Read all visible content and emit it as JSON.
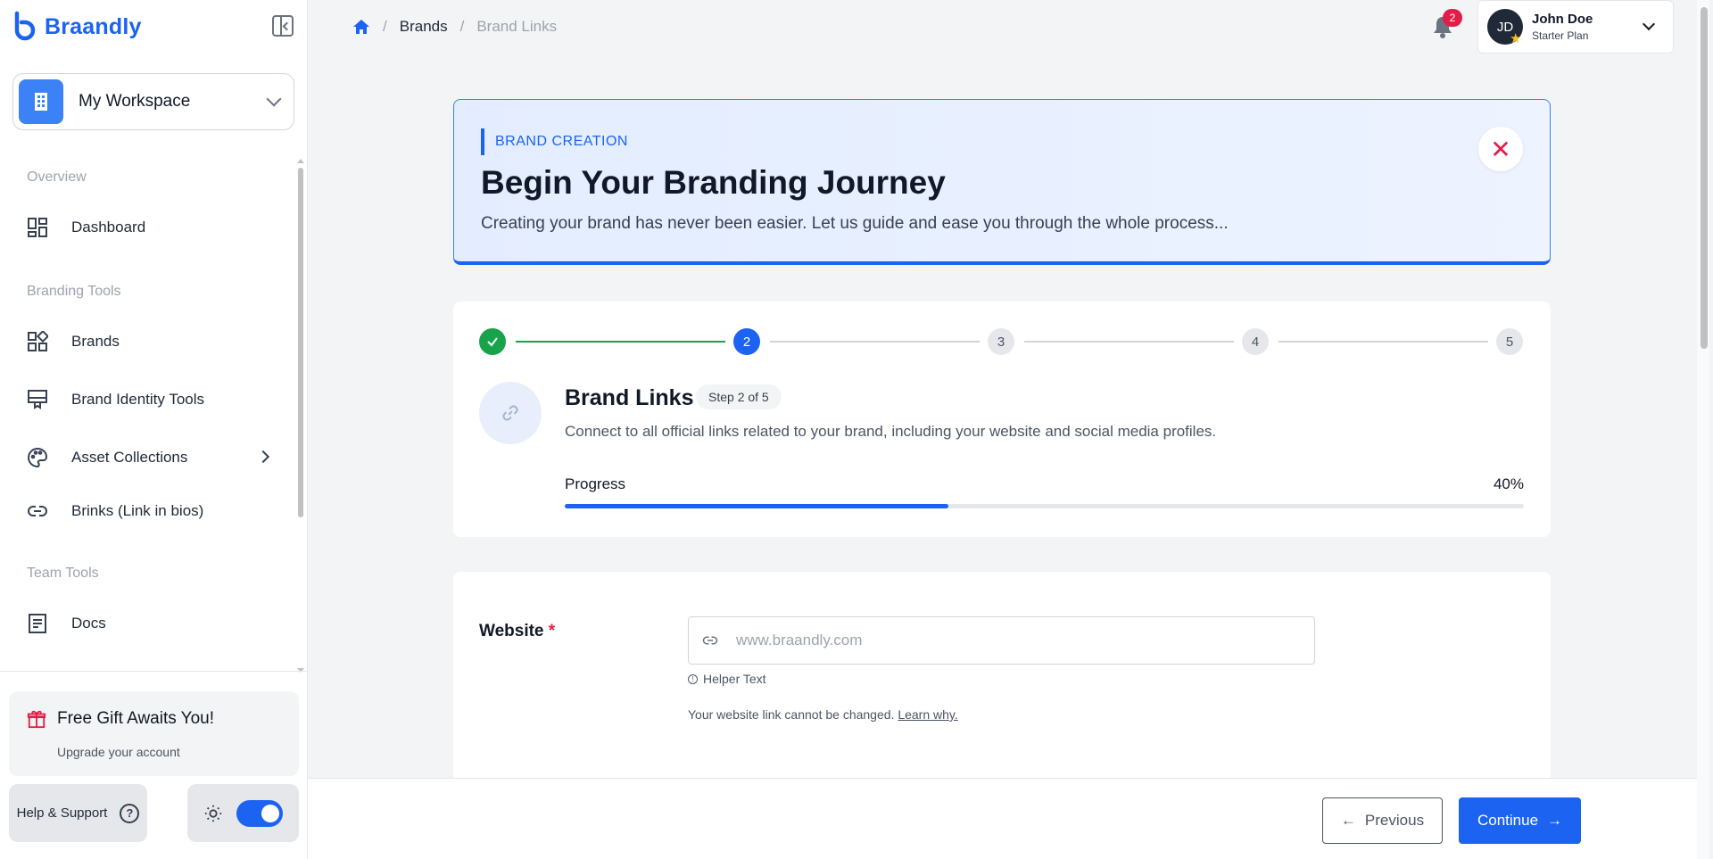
{
  "app": {
    "name": "Braandly",
    "brand_color": "#1b63f0"
  },
  "workspace": {
    "label": "My Workspace"
  },
  "sidebar": {
    "sections": [
      {
        "label": "Overview"
      },
      {
        "label": "Branding Tools"
      },
      {
        "label": "Team Tools"
      }
    ],
    "items": [
      {
        "label": "Dashboard",
        "icon": "dashboard-icon"
      },
      {
        "label": "Brands",
        "icon": "brands-icon"
      },
      {
        "label": "Brand Identity Tools",
        "icon": "monitor-icon"
      },
      {
        "label": "Asset Collections",
        "icon": "palette-icon"
      },
      {
        "label": "Brinks (Link in bios)",
        "icon": "link-icon"
      },
      {
        "label": "Docs",
        "icon": "document-icon"
      }
    ],
    "gift": {
      "title": "Free Gift Awaits You!",
      "subtitle": "Upgrade your account"
    },
    "help_label": "Help & Support"
  },
  "breadcrumb": {
    "items": [
      "Brands",
      "Brand Links"
    ]
  },
  "notifications": {
    "count": "2"
  },
  "user": {
    "initials": "JD",
    "name": "John Doe",
    "plan": "Starter Plan"
  },
  "banner": {
    "eyebrow": "BRAND CREATION",
    "title": "Begin Your Branding Journey",
    "description": "Creating your brand has never been easier. Let us guide and ease you through the whole process..."
  },
  "stepper": {
    "steps": [
      "1",
      "2",
      "3",
      "4",
      "5"
    ],
    "current_step": 2,
    "title": "Brand Links",
    "pill": "Step 2 of 5",
    "description": "Connect to all official links related to your brand, including your website and social media profiles.",
    "progress_label": "Progress",
    "progress_text": "40%",
    "progress_value": 0.4
  },
  "form": {
    "website_label": "Website",
    "required_mark": "*",
    "website_placeholder": "www.braandly.com",
    "helper_text": "Helper Text",
    "note_text": "Your website link cannot be changed.",
    "note_link": "Learn why."
  },
  "footer": {
    "previous_label": "Previous",
    "continue_label": "Continue"
  }
}
